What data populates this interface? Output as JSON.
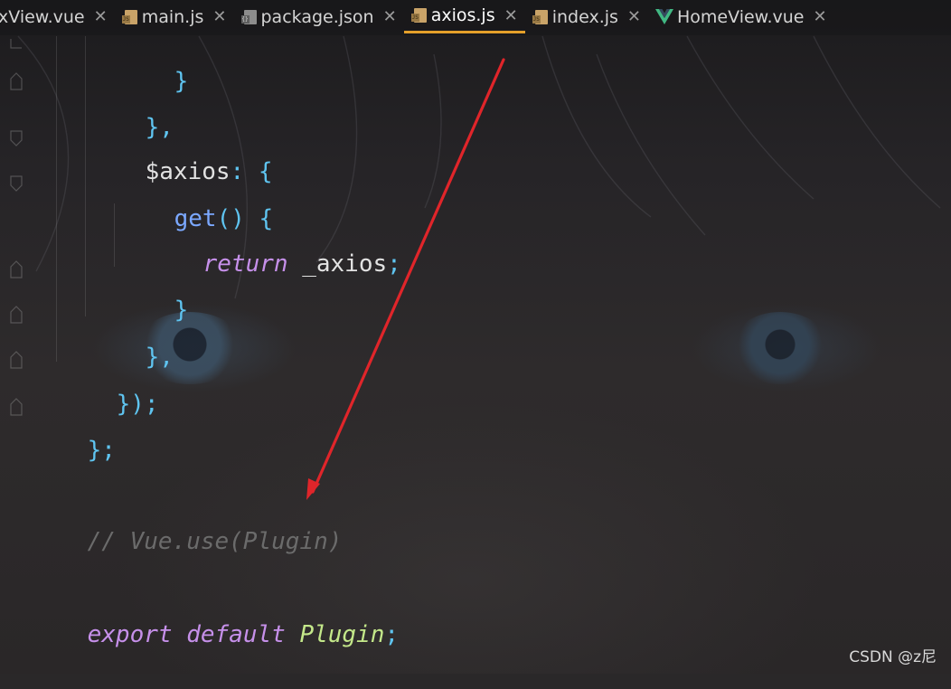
{
  "tabs": [
    {
      "label": "xView.vue",
      "icon": "vue-file-icon",
      "active": false
    },
    {
      "label": "main.js",
      "icon": "js-file-icon",
      "active": false
    },
    {
      "label": "package.json",
      "icon": "json-file-icon",
      "active": false
    },
    {
      "label": "axios.js",
      "icon": "js-file-icon",
      "active": true
    },
    {
      "label": "index.js",
      "icon": "js-file-icon",
      "active": false
    },
    {
      "label": "HomeView.vue",
      "icon": "vue-logo-icon",
      "active": false
    }
  ],
  "close_glyph": "✕",
  "code": {
    "l1": "}",
    "l2": "},",
    "l3_ident": "$axios",
    "l3_punc": ": {",
    "l4_fn": "get",
    "l4_punc": "() {",
    "l5_kw": "return",
    "l5_ident": " _axios",
    "l5_semi": ";",
    "l6": "}",
    "l7": "},",
    "l8": "});",
    "l9": "};",
    "comment": "// Vue.use(Plugin)",
    "export_kw1": "export",
    "export_kw2": "default",
    "export_cls": "Plugin",
    "export_semi": ";"
  },
  "annotation": {
    "color": "#e0252a",
    "icon": "red-arrow"
  },
  "colors": {
    "active_tab_underline": "#e5a02a",
    "punctuation": "#5fc4f0",
    "keyword": "#c690ea",
    "function": "#7ba8ff",
    "class": "#c4e88a",
    "comment": "#6b6b6b"
  },
  "watermark": "CSDN @z尼"
}
